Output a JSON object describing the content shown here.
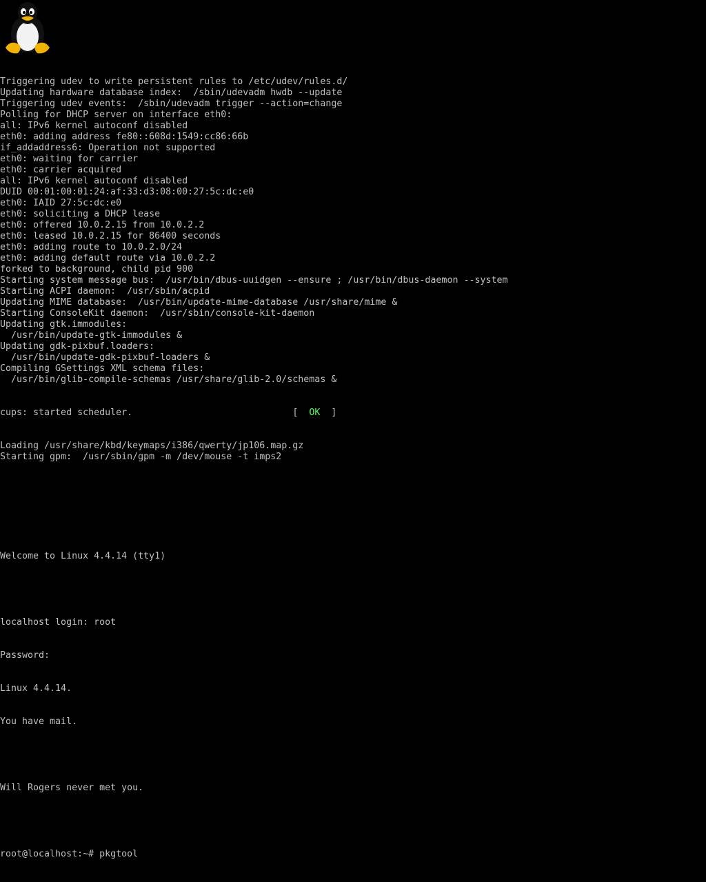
{
  "colors": {
    "background": "#000000",
    "text": "#c0c0c0",
    "ok": "#55ff55"
  },
  "logo": {
    "icon": "tux-penguin-icon"
  },
  "lines": [
    "Triggering udev to write persistent rules to /etc/udev/rules.d/",
    "Updating hardware database index:  /sbin/udevadm hwdb --update",
    "Triggering udev events:  /sbin/udevadm trigger --action=change",
    "Polling for DHCP server on interface eth0:",
    "all: IPv6 kernel autoconf disabled",
    "eth0: adding address fe80::608d:1549:cc86:66b",
    "if_addaddress6: Operation not supported",
    "eth0: waiting for carrier",
    "eth0: carrier acquired",
    "all: IPv6 kernel autoconf disabled",
    "DUID 00:01:00:01:24:af:33:d3:08:00:27:5c:dc:e0",
    "eth0: IAID 27:5c:dc:e0",
    "eth0: soliciting a DHCP lease",
    "eth0: offered 10.0.2.15 from 10.0.2.2",
    "eth0: leased 10.0.2.15 for 86400 seconds",
    "eth0: adding route to 10.0.2.0/24",
    "eth0: adding default route via 10.0.2.2",
    "forked to background, child pid 900",
    "Starting system message bus:  /usr/bin/dbus-uuidgen --ensure ; /usr/bin/dbus-daemon --system",
    "Starting ACPI daemon:  /usr/sbin/acpid",
    "Updating MIME database:  /usr/bin/update-mime-database /usr/share/mime &",
    "Starting ConsoleKit daemon:  /usr/sbin/console-kit-daemon",
    "Updating gtk.immodules:",
    "  /usr/bin/update-gtk-immodules &",
    "Updating gdk-pixbuf.loaders:",
    "  /usr/bin/update-gdk-pixbuf-loaders &",
    "Compiling GSettings XML schema files:",
    "  /usr/bin/glib-compile-schemas /usr/share/glib-2.0/schemas &"
  ],
  "cups_line": {
    "text": "cups: started scheduler.",
    "bracket_open": "[",
    "status": "OK",
    "bracket_close": "]"
  },
  "lines_after_cups": [
    "Loading /usr/share/kbd/keymaps/i386/qwerty/jp106.map.gz",
    "Starting gpm:  /usr/sbin/gpm -m /dev/mouse -t imps2"
  ],
  "welcome": "Welcome to Linux 4.4.14 (tty1)",
  "login": {
    "prompt": "localhost login: ",
    "user": "root",
    "password_label": "Password:"
  },
  "motd": [
    "Linux 4.4.14.",
    "You have mail."
  ],
  "fortune": "Will Rogers never met you.",
  "shell": {
    "prompt": "root@localhost:~# ",
    "command": "pkgtool"
  }
}
